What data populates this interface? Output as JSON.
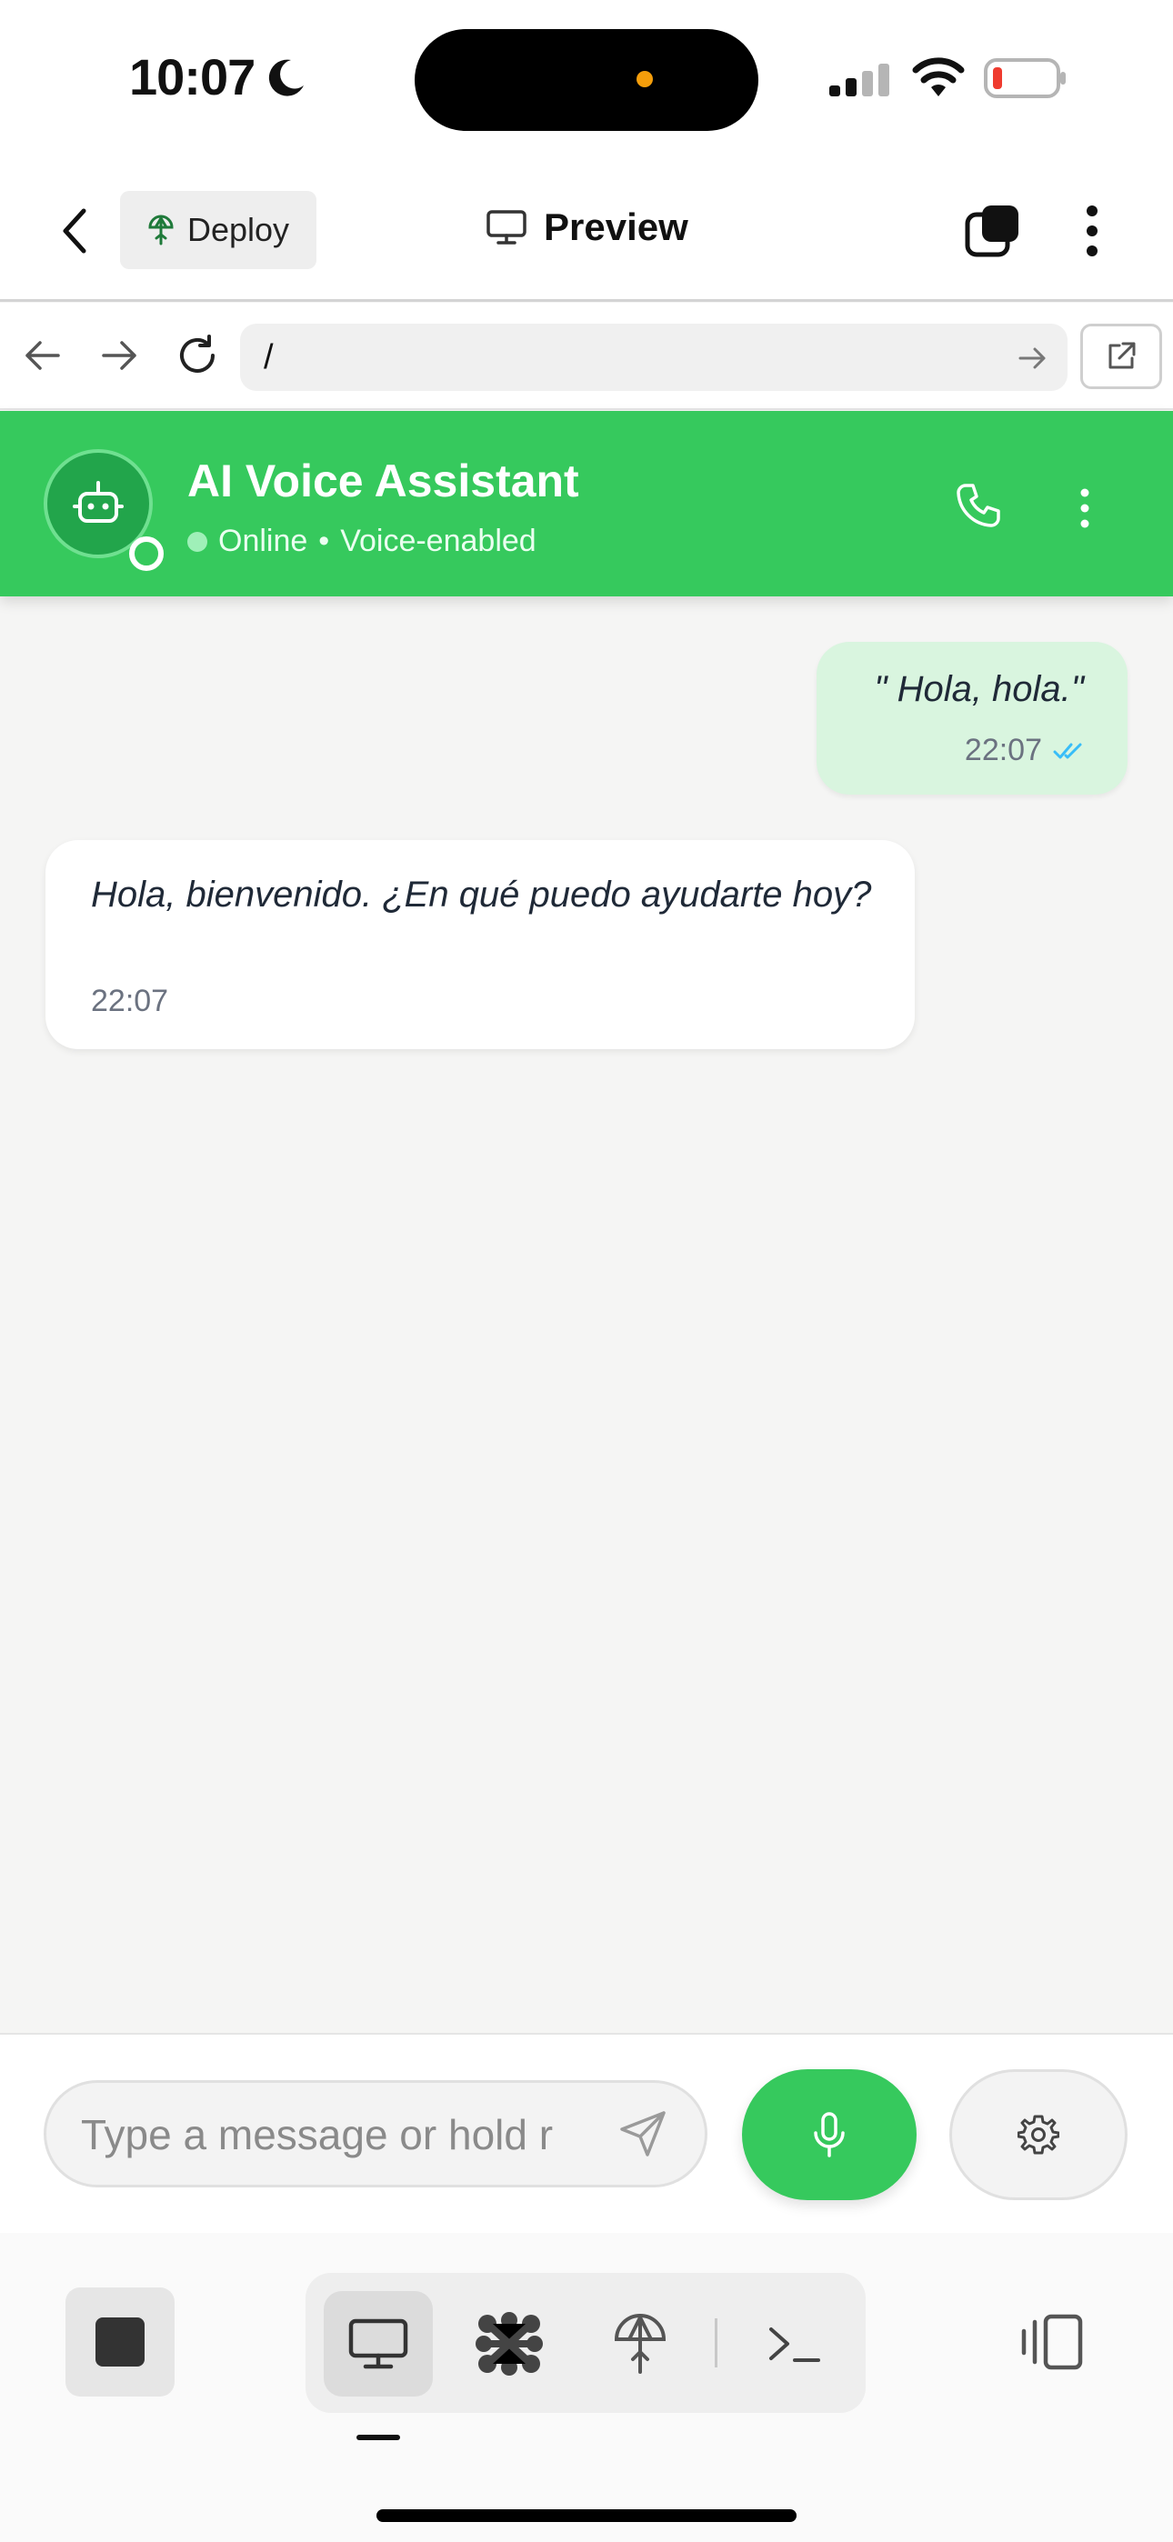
{
  "status_bar": {
    "time": "10:07"
  },
  "app_header": {
    "deploy_label": "Deploy",
    "preview_label": "Preview"
  },
  "browser": {
    "url": "/"
  },
  "chat": {
    "title": "AI Voice Assistant",
    "status": "Online",
    "separator": "•",
    "capability": "Voice-enabled",
    "accent_color": "#36c95d"
  },
  "messages": [
    {
      "direction": "outgoing",
      "text": "\" Hola, hola.\"",
      "time": "22:07",
      "read": true
    },
    {
      "direction": "incoming",
      "text": "Hola, bienvenido. ¿En qué puedo ayudarte hoy?",
      "time": "22:07"
    }
  ],
  "composer": {
    "placeholder": "Type a message or hold r"
  },
  "toolbar": {
    "tools": [
      "preview-icon",
      "apps-icon",
      "deploy-icon",
      "terminal-icon"
    ],
    "active": "preview-icon"
  }
}
